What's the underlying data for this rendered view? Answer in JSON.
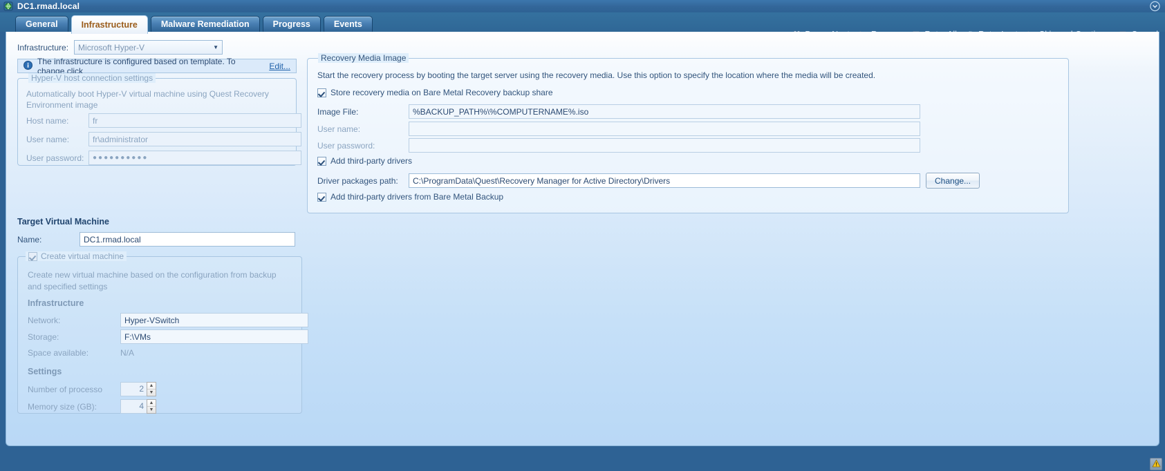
{
  "window": {
    "title": "DC1.rmad.local",
    "icon": "server-globe-icon",
    "restore_icon": "chevron-down-circle-icon"
  },
  "tabs": [
    {
      "label": "General",
      "active": false
    },
    {
      "label": "Infrastructure",
      "active": true
    },
    {
      "label": "Malware Remediation",
      "active": false
    },
    {
      "label": "Progress",
      "active": false
    },
    {
      "label": "Events",
      "active": false
    }
  ],
  "toolbar": [
    {
      "label": "Pause Next",
      "icon": "pause-icon"
    },
    {
      "label": "Resume",
      "icon": "play-icon"
    },
    {
      "label": "Retry All",
      "icon": "retry-all-icon"
    },
    {
      "label": "Retry Last",
      "icon": "retry-last-icon"
    },
    {
      "label": "Skip and Continue",
      "icon": "play-icon"
    },
    {
      "label": "Cancel",
      "icon": "stop-icon"
    }
  ],
  "left": {
    "infrastructure_label": "Infrastructure:",
    "infrastructure_value": "Microsoft Hyper-V",
    "info_icon": "info-icon",
    "info_text": "The infrastructure is configured based on template. To change click",
    "info_link": "Edit...",
    "host_group": {
      "caption": "Hyper-V host connection settings",
      "description": "Automatically boot Hyper-V virtual machine using Quest Recovery Environment image",
      "fields": [
        {
          "label": "Host name:",
          "value": "fr"
        },
        {
          "label": "User name:",
          "value": "fr\\administrator"
        },
        {
          "label": "User password:",
          "value": "●●●●●●●●●●"
        }
      ]
    },
    "target_vm": {
      "heading": "Target Virtual Machine",
      "name_label": "Name:",
      "name_value": "DC1.rmad.local"
    },
    "create_vm": {
      "caption": "Create virtual machine",
      "checked": true,
      "description": "Create new virtual machine based on the configuration from backup and specified settings",
      "infrastructure_heading": "Infrastructure",
      "network_label": "Network:",
      "network_value": "Hyper-VSwitch",
      "storage_label": "Storage:",
      "storage_value": "F:\\VMs",
      "space_label": "Space available:",
      "space_value": "N/A",
      "settings_heading": "Settings",
      "processors_label": "Number of processo",
      "processors_value": "2",
      "memory_label": "Memory size (GB):",
      "memory_value": "4"
    }
  },
  "right": {
    "caption": "Recovery Media Image",
    "description": "Start the recovery process by booting the target server using the recovery media. Use this option to specify the location where the media will be created.",
    "store_media_label": "Store recovery media on Bare Metal Recovery backup share",
    "store_media_checked": true,
    "image_file_label": "Image File:",
    "image_file_value": "%BACKUP_PATH%\\%COMPUTERNAME%.iso",
    "user_name_label": "User name:",
    "user_name_value": "",
    "user_password_label": "User password:",
    "user_password_value": "",
    "add_drivers_label": "Add third-party drivers",
    "add_drivers_checked": true,
    "driver_path_label": "Driver packages path:",
    "driver_path_value": "C:\\ProgramData\\Quest\\Recovery Manager for Active Directory\\Drivers",
    "change_button": "Change...",
    "add_drivers_bmb_label": "Add third-party drivers from Bare Metal Backup",
    "add_drivers_bmb_checked": true
  },
  "statusbar": {
    "warning_icon": "warning-triangle-icon"
  },
  "colors": {
    "titlebar": "#336699",
    "accent": "#2e6294",
    "active_tab_text": "#9a5c1a",
    "page_bg": "#c6e0f8",
    "warning": "#f5c518"
  }
}
